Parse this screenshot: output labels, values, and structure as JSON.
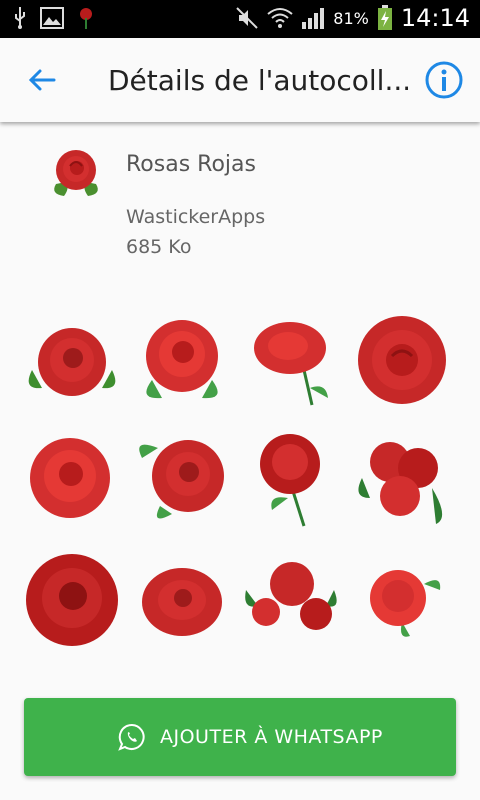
{
  "status_bar": {
    "battery_percent": "81%",
    "time": "14:14",
    "icons": [
      "usb-icon",
      "image-icon",
      "rose-notification-icon",
      "mute-icon",
      "wifi-icon",
      "signal-icon",
      "battery-charging-icon"
    ]
  },
  "app_bar": {
    "title": "Détails de l'autocoll...",
    "back_icon": "arrow-back-icon",
    "info_icon": "info-icon",
    "accent_color": "#1e88e5"
  },
  "pack": {
    "name": "Rosas Rojas",
    "publisher": "WastickerApps",
    "size": "685 Ko"
  },
  "stickers": [
    "rose",
    "rose",
    "rose",
    "rose",
    "rose",
    "rose",
    "rose",
    "rose",
    "rose",
    "rose",
    "rose",
    "rose"
  ],
  "cta": {
    "label": "AJOUTER À WHATSAPP",
    "icon": "whatsapp-icon",
    "color": "#3fb24b"
  }
}
